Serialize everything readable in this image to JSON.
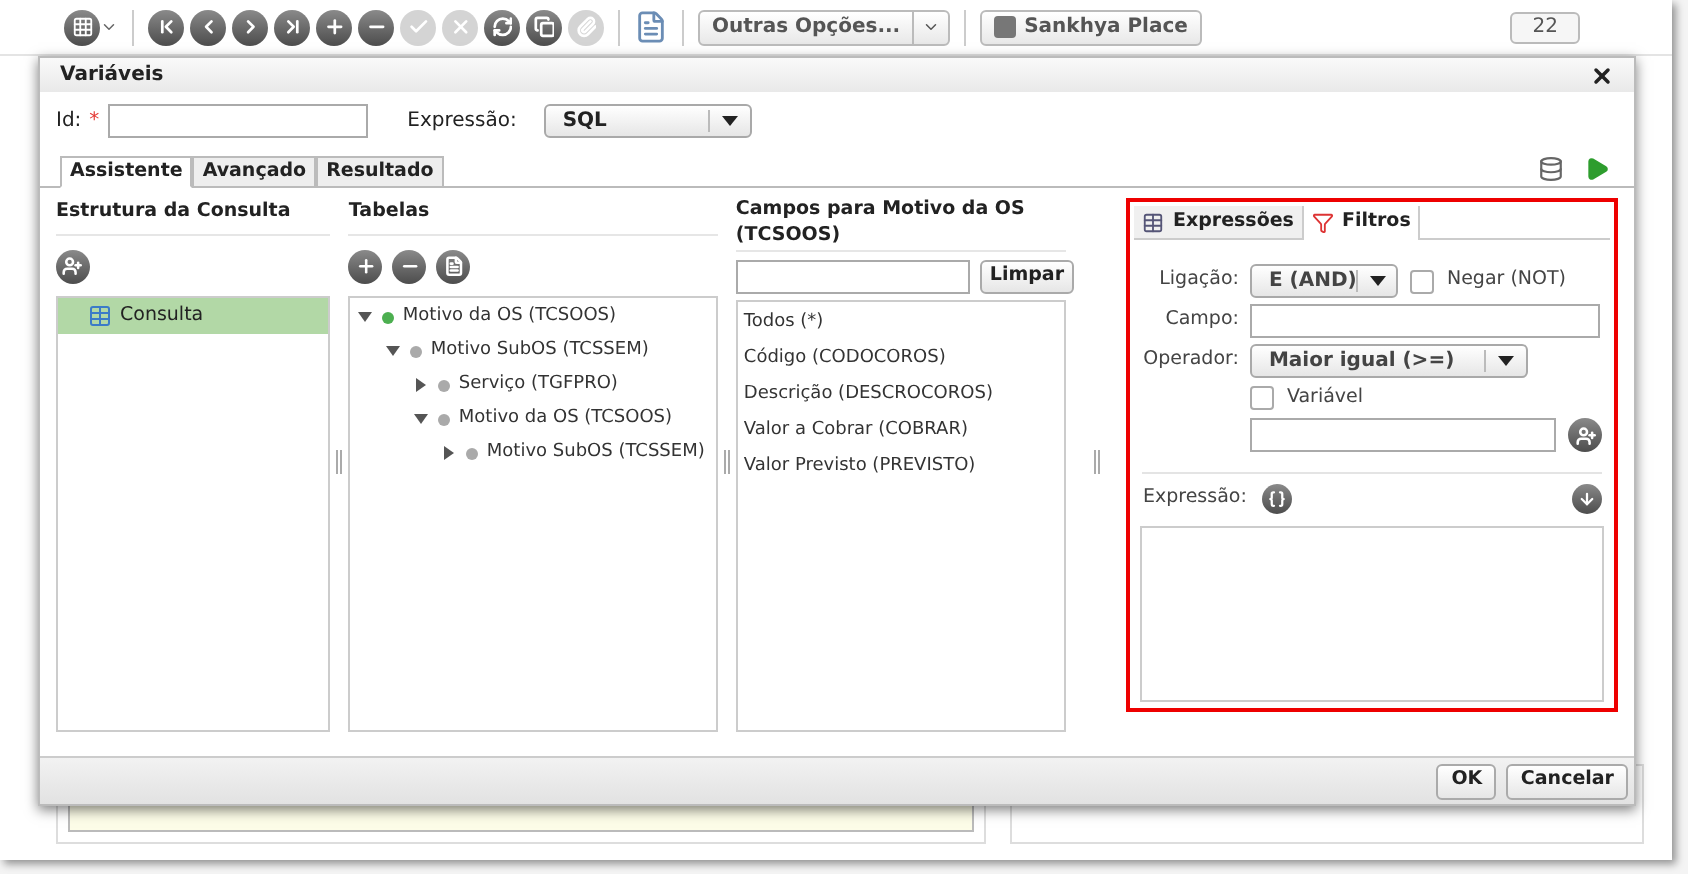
{
  "toolbar": {
    "buttons": [
      {
        "kind": "first",
        "disabled": false
      },
      {
        "kind": "prev",
        "disabled": false
      },
      {
        "kind": "next",
        "disabled": false
      },
      {
        "kind": "last",
        "disabled": false
      },
      {
        "kind": "add",
        "disabled": false
      },
      {
        "kind": "remove",
        "disabled": false
      },
      {
        "kind": "confirm",
        "disabled": true
      },
      {
        "kind": "cancel",
        "disabled": true
      },
      {
        "kind": "refresh",
        "disabled": false
      },
      {
        "kind": "copy",
        "disabled": false
      },
      {
        "kind": "attach",
        "disabled": true
      }
    ],
    "options_dropdown": "Outras Opções...",
    "place_button": "Sankhya Place",
    "badge": "22"
  },
  "dialog": {
    "title": "Variáveis",
    "id_label": "Id:",
    "required_mark": "*",
    "expression_label": "Expressão:",
    "expression_value": "SQL",
    "tabs": [
      {
        "label": "Assistente",
        "selected": true
      },
      {
        "label": "Avançado",
        "selected": false
      },
      {
        "label": "Resultado",
        "selected": false
      }
    ],
    "structure": {
      "title": "Estrutura da Consulta",
      "items": [
        {
          "label": "Consulta",
          "selected": true
        }
      ]
    },
    "tables": {
      "title": "Tabelas",
      "tree": [
        {
          "label": "Motivo da OS (TCSOOS)",
          "expanded": true,
          "active": true,
          "children": [
            {
              "label": "Motivo SubOS (TCSSEM)",
              "expanded": true,
              "active": false,
              "children": [
                {
                  "label": "Serviço (TGFPRO)",
                  "expanded": false,
                  "active": false
                },
                {
                  "label": "Motivo da OS (TCSOOS)",
                  "expanded": true,
                  "active": false,
                  "children": [
                    {
                      "label": "Motivo SubOS (TCSSEM)",
                      "expanded": false,
                      "active": false
                    }
                  ]
                }
              ]
            }
          ]
        }
      ]
    },
    "fields": {
      "title": "Campos para Motivo da OS (TCSOOS)",
      "clear_button": "Limpar",
      "items": [
        "Todos (*)",
        "Código (CODOCOROS)",
        "Descrição (DESCROCOROS)",
        "Valor a Cobrar (COBRAR)",
        "Valor Previsto (PREVISTO)"
      ]
    },
    "filter_panel": {
      "tabs": [
        {
          "label": "Expressões",
          "selected": false
        },
        {
          "label": "Filtros",
          "selected": true
        }
      ],
      "link_label": "Ligação:",
      "link_value": "E (AND)",
      "negate": {
        "label": "Negar (NOT)",
        "checked": false
      },
      "field_label": "Campo:",
      "operator_label": "Operador:",
      "operator_value": "Maior igual (>=)",
      "variable": {
        "label": "Variável",
        "checked": false
      },
      "expression_label": "Expressão:"
    },
    "buttons": [
      "OK",
      "Cancelar"
    ]
  }
}
